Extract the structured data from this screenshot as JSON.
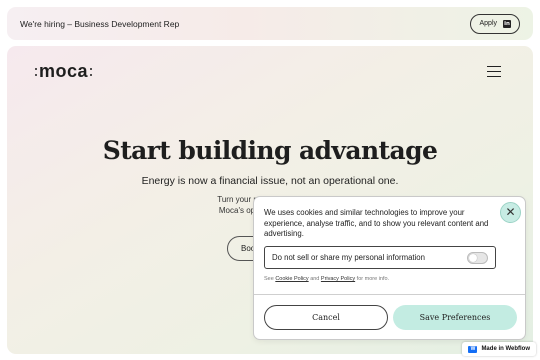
{
  "announcement": {
    "text": "We're hiring – Business Development Rep",
    "apply_label": "Apply",
    "apply_icon": "linkedin-icon"
  },
  "nav": {
    "logo_text_left": "moca",
    "menu_icon": "hamburger-menu-icon"
  },
  "hero": {
    "title": "Start building advantage",
    "subtitle": "Energy is now a financial issue, not an operational one.",
    "body_line1": "Turn your property",
    "body_line2": "Moca's operatio",
    "cta_label": "Boo"
  },
  "cookie_banner": {
    "message": "We uses cookies and similar technologies to improve your experience, analyse traffic, and to show you relevant content and advertising.",
    "optout_label": "Do not sell or share my personal information",
    "optout_enabled": false,
    "policy_prefix": "See",
    "cookie_policy_link": "Cookie Policy",
    "policy_and": "and",
    "privacy_policy_link": "Privacy Policy",
    "policy_suffix": "for more info.",
    "cancel_label": "Cancel",
    "save_label": "Save Preferences",
    "close_icon": "close-icon",
    "accent_color": "#c3ece2"
  },
  "badge": {
    "label": "Made in Webflow",
    "icon": "webflow-icon",
    "icon_color": "#146ef5"
  }
}
